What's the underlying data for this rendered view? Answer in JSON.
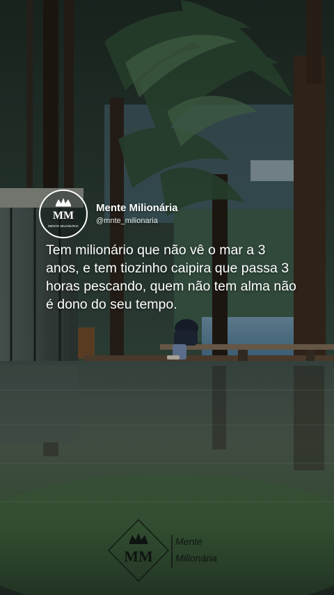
{
  "post": {
    "author_name": "Mente Milionária",
    "author_handle": "@mnte_milionaria",
    "avatar_monogram": "MM",
    "avatar_caption": "MENTE MILIONÁRIA",
    "quote": "Tem milionário que não vê o mar a 3 anos, e tem tiozinho caipira que passa 3 horas pescando, quem não tem alma não é dono do seu tempo."
  },
  "watermark": {
    "monogram": "MM",
    "line1": "Mente",
    "line2": "Milionária"
  },
  "colors": {
    "text": "#ffffff",
    "water": "#3a4e42",
    "lake": "#5d87a2",
    "fern": "#2f4a34"
  },
  "icons": [
    "crown-icon",
    "diamond-frame-icon"
  ]
}
